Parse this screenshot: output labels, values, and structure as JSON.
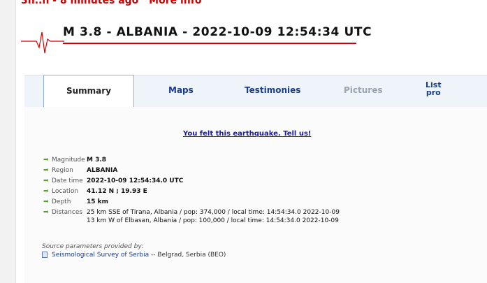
{
  "banner": {
    "text": "3h..n - 8 minutes ago",
    "more_link": "More info"
  },
  "title": "M 3.8 - ALBANIA - 2022-10-09 12:54:34 UTC",
  "tabs": [
    {
      "label": "Summary",
      "active": true
    },
    {
      "label": "Maps"
    },
    {
      "label": "Testimonies"
    },
    {
      "label": "Pictures",
      "disabled": true
    },
    {
      "label_line1": "List",
      "label_line2": "pro"
    }
  ],
  "felt_link": "You felt this earthquake. Tell us!",
  "details": {
    "magnitude": {
      "label": "Magnitude",
      "value": "M 3.8"
    },
    "region": {
      "label": "Region",
      "value": "ALBANIA"
    },
    "datetime": {
      "label": "Date time",
      "value": "2022-10-09 12:54:34.0 UTC"
    },
    "location": {
      "label": "Location",
      "value": "41.12 N ; 19.93 E"
    },
    "depth": {
      "label": "Depth",
      "value": "15 km"
    },
    "distances": {
      "label": "Distances",
      "line1": "25 km SSE of Tirana, Albania / pop: 374,000 / local time: 14:54:34.0 2022-10-09",
      "line2": "13 km W of Elbasan, Albania / pop: 100,000 / local time: 14:54:34.0 2022-10-09"
    }
  },
  "source": {
    "label": "Source parameters provided by:",
    "agency": "Seismological Survey of Serbia",
    "rest": " -- Belgrad, Serbia (BEO)"
  },
  "colors": {
    "accent_red": "#d40000",
    "tab_blue": "#1a3c8c",
    "arrow_green": "#5aa02c"
  }
}
